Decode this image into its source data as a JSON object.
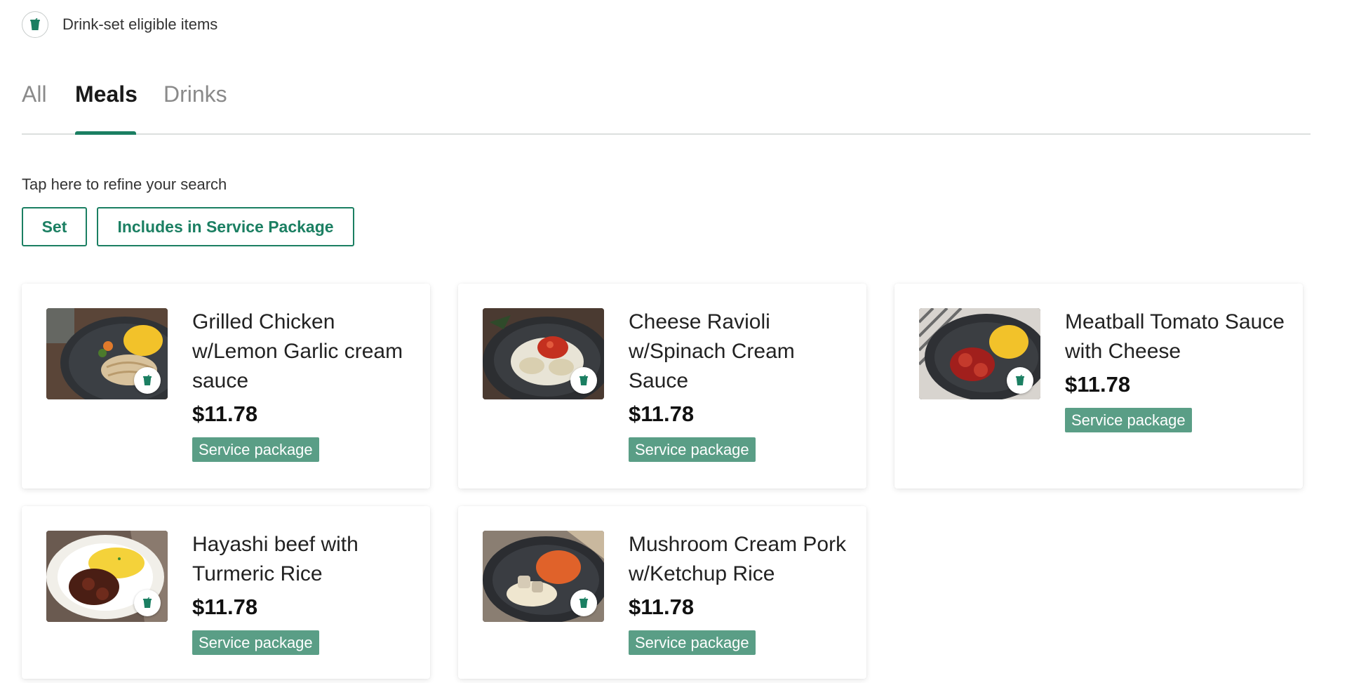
{
  "legend": {
    "icon": "drink-cup-icon",
    "text": "Drink-set eligible items"
  },
  "tabs": [
    {
      "label": "All",
      "active": false
    },
    {
      "label": "Meals",
      "active": true
    },
    {
      "label": "Drinks",
      "active": false
    }
  ],
  "refine": {
    "label": "Tap here to refine your search",
    "filters": [
      {
        "label": "Set"
      },
      {
        "label": "Includes in Service Package"
      }
    ]
  },
  "colors": {
    "accent": "#1b7f62",
    "tag_background": "#5a9e86"
  },
  "items": [
    {
      "name": "Grilled Chicken w/Lemon Garlic cream sauce",
      "price": "$11.78",
      "tag": "Service package",
      "drink_icon": "drink-cup-icon"
    },
    {
      "name": "Cheese Ravioli w/Spinach Cream Sauce",
      "price": "$11.78",
      "tag": "Service package",
      "drink_icon": "drink-cup-icon"
    },
    {
      "name": "Meatball Tomato Sauce with Cheese",
      "price": "$11.78",
      "tag": "Service package",
      "drink_icon": "drink-cup-icon"
    },
    {
      "name": "Hayashi beef with Turmeric Rice",
      "price": "$11.78",
      "tag": "Service package",
      "drink_icon": "drink-cup-icon"
    },
    {
      "name": "Mushroom Cream Pork w/Ketchup Rice",
      "price": "$11.78",
      "tag": "Service package",
      "drink_icon": "drink-cup-icon"
    }
  ]
}
